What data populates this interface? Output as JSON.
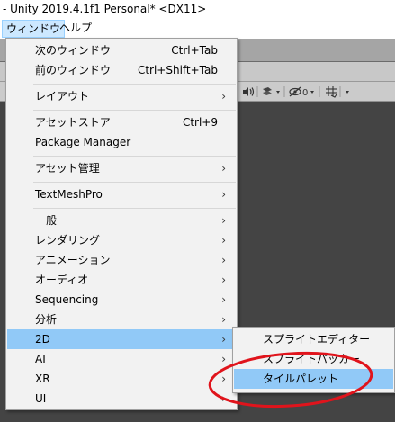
{
  "window": {
    "title": "- Unity 2019.4.1f1 Personal* <DX11>"
  },
  "menubar": {
    "items": [
      {
        "label": "ウィンドウ",
        "active": true
      },
      {
        "label": "ヘルプ",
        "active": false
      }
    ]
  },
  "scene_toolbar": {
    "audio_icon": "speaker-icon",
    "effects_icon": "effects-icon",
    "visibility_icon": "eye-slash-icon",
    "hidden_count": "0",
    "grid_icon": "grid-icon"
  },
  "dropdown": {
    "items": [
      {
        "label": "次のウィンドウ",
        "shortcut": "Ctrl+Tab",
        "submenu": false
      },
      {
        "label": "前のウィンドウ",
        "shortcut": "Ctrl+Shift+Tab",
        "submenu": false
      },
      {
        "label": "レイアウト",
        "shortcut": "",
        "submenu": true
      },
      {
        "label": "アセットストア",
        "shortcut": "Ctrl+9",
        "submenu": false
      },
      {
        "label": "Package Manager",
        "shortcut": "",
        "submenu": false
      },
      {
        "label": "アセット管理",
        "shortcut": "",
        "submenu": true
      },
      {
        "label": "TextMeshPro",
        "shortcut": "",
        "submenu": true
      },
      {
        "label": "一般",
        "shortcut": "",
        "submenu": true
      },
      {
        "label": "レンダリング",
        "shortcut": "",
        "submenu": true
      },
      {
        "label": "アニメーション",
        "shortcut": "",
        "submenu": true
      },
      {
        "label": "オーディオ",
        "shortcut": "",
        "submenu": true
      },
      {
        "label": "Sequencing",
        "shortcut": "",
        "submenu": true
      },
      {
        "label": "分析",
        "shortcut": "",
        "submenu": true
      },
      {
        "label": "2D",
        "shortcut": "",
        "submenu": true,
        "highlighted": true
      },
      {
        "label": "AI",
        "shortcut": "",
        "submenu": true
      },
      {
        "label": "XR",
        "shortcut": "",
        "submenu": true
      },
      {
        "label": "UI",
        "shortcut": "",
        "submenu": true
      }
    ],
    "arrow": "›"
  },
  "submenu_2d": {
    "items": [
      {
        "label": "スプライトエディター",
        "highlighted": false
      },
      {
        "label": "スプライトパッカー",
        "highlighted": false
      },
      {
        "label": "タイルパレット",
        "highlighted": true
      }
    ]
  },
  "colors": {
    "highlight": "#91c9f7",
    "annotation": "#e0141c",
    "scene_bg": "#444444"
  }
}
